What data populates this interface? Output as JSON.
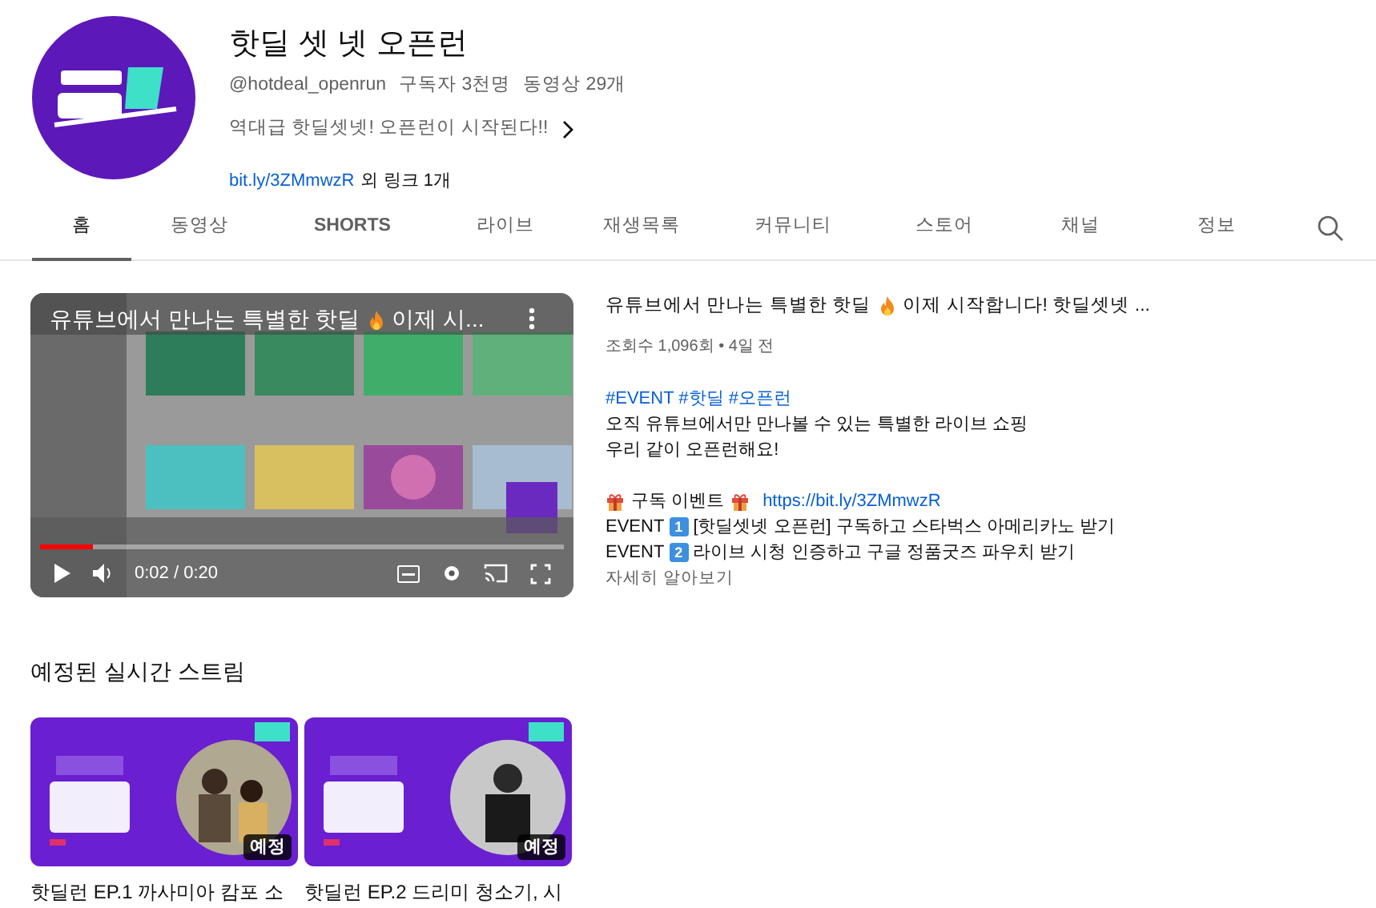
{
  "channel": {
    "name": "핫딜 셋 넷 오픈런",
    "handle": "@hotdeal_openrun",
    "subscribers": "구독자 3천명",
    "videos": "동영상 29개",
    "description": "역대급 핫딜셋넷! 오픈런이 시작된다!!",
    "link": "bit.ly/3ZMmwzR",
    "link_more": "외 링크 1개"
  },
  "tabs": [
    {
      "label": "홈",
      "selected": true
    },
    {
      "label": "동영상",
      "selected": false
    },
    {
      "label": "SHORTS",
      "selected": false
    },
    {
      "label": "라이브",
      "selected": false
    },
    {
      "label": "재생목록",
      "selected": false
    },
    {
      "label": "커뮤니티",
      "selected": false
    },
    {
      "label": "스토어",
      "selected": false
    },
    {
      "label": "채널",
      "selected": false
    },
    {
      "label": "정보",
      "selected": false
    }
  ],
  "featured": {
    "player": {
      "title_before": "유튜브에서 만나는 특별한 핫딜",
      "title_after": "이제 시...",
      "time": "0:02 / 0:20",
      "level": 0.1
    },
    "title_before": "유튜브에서 만나는 특별한 핫딜",
    "title_after": "이제 시작합니다! 핫딜셋넷 ...",
    "meta": "조회수 1,096회 • 4일 전",
    "hashtags": "#EVENT #핫딜 #오픈런",
    "lines": [
      "오직 유튜브에서만 만나볼 수 있는 특별한 라이브 쇼핑",
      "우리 같이 오픈런해요!"
    ],
    "event_heading": "구독 이벤트",
    "event_link": "https://bit.ly/3ZMmwzR",
    "events": [
      {
        "label": "EVENT",
        "number": "1",
        "text": "[핫딜셋넷 오픈런] 구독하고 스타벅스 아메리카노 받기"
      },
      {
        "label": "EVENT",
        "number": "2",
        "text": "라이브 시청 인증하고 구글 정품굿즈 파우치 받기"
      }
    ],
    "more": "자세히 알아보기"
  },
  "upcoming": {
    "heading": "예정된 실시간 스트림",
    "items": [
      {
        "badge": "예정",
        "title": "핫딜런 EP.1 까사미아 캄포 소"
      },
      {
        "badge": "예정",
        "title": "핫딜런 EP.2 드리미 청소기, 시"
      }
    ]
  }
}
